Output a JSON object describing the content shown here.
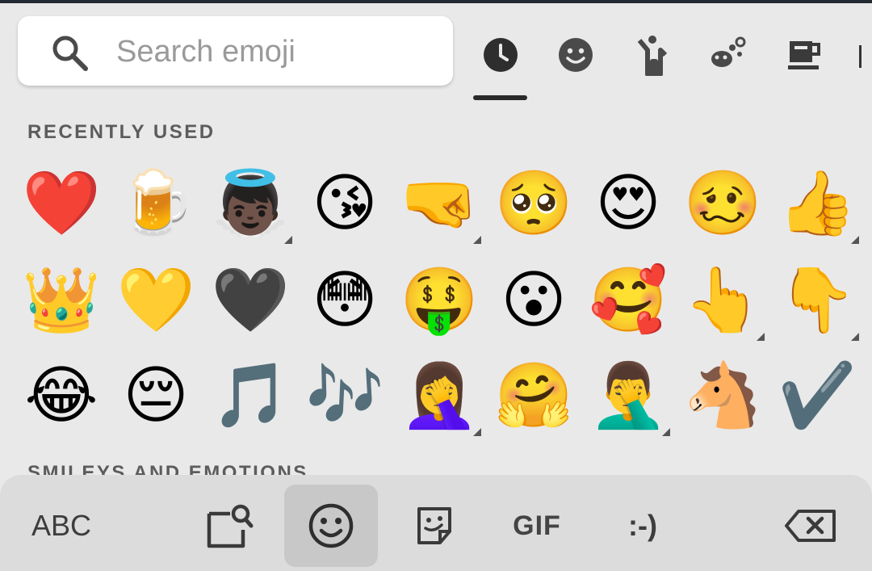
{
  "search": {
    "placeholder": "Search emoji"
  },
  "categories": [
    {
      "icon": "clock-icon",
      "selected": true
    },
    {
      "icon": "smiley-icon"
    },
    {
      "icon": "person-icon"
    },
    {
      "icon": "animals-icon"
    },
    {
      "icon": "food-icon"
    }
  ],
  "sections": {
    "recent": "RECENTLY USED",
    "smileys": "SMILEYS AND EMOTIONS"
  },
  "emoji_rows": [
    [
      "❤️",
      "🍺",
      "👼🏿",
      "😘",
      "🤜",
      "🥺",
      "😍",
      "🥴",
      "👍"
    ],
    [
      "👑",
      "💛",
      "🖤",
      "😳",
      "🤑",
      "😮",
      "🥰",
      "👆",
      "👇"
    ],
    [
      "😂",
      "😔",
      "🎵",
      "🎶",
      "🤦‍♀️",
      "🤗",
      "🤦‍♂️",
      "🐴",
      "✔️"
    ]
  ],
  "toolbar": {
    "abc_label": "ABC",
    "gif_label": "GIF",
    "emoticon_label": ":-)"
  },
  "colors": {
    "background": "#e9e9e9",
    "toolbar": "#dcdcdc",
    "active_tab": "#c8c8c8"
  }
}
